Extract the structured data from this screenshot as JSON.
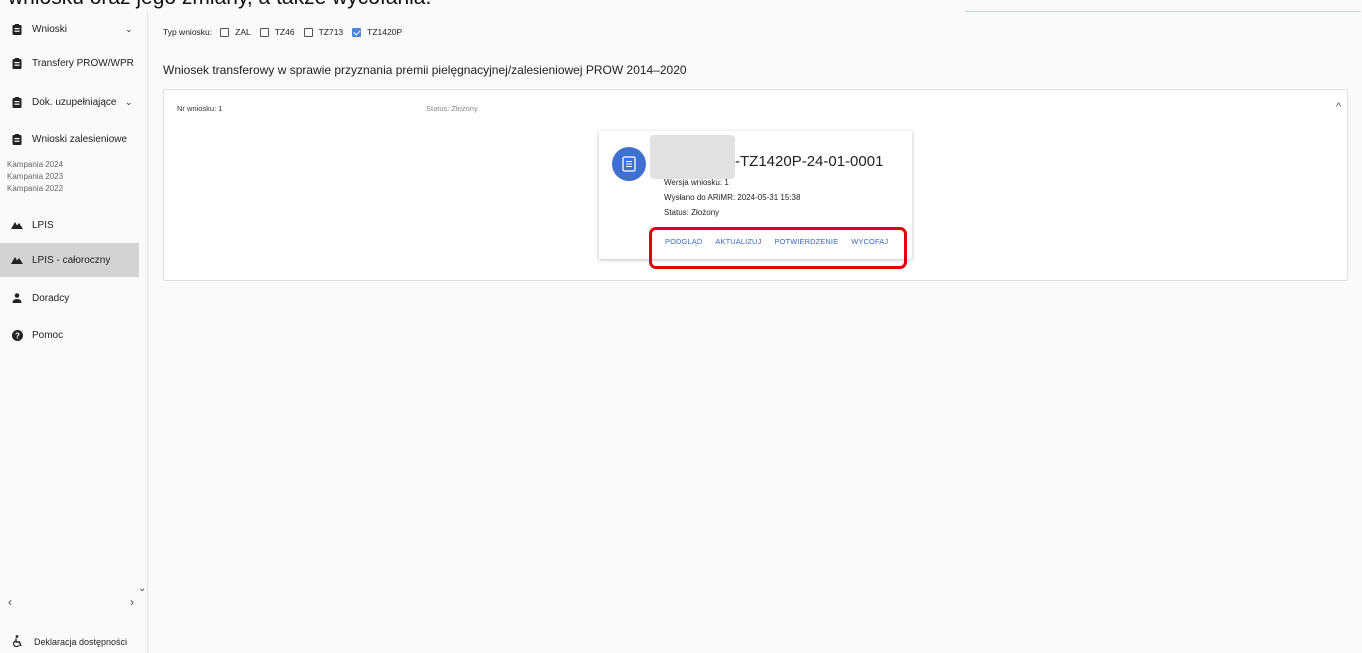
{
  "caption": {
    "text": "wniosku oraz jego zmiany, a także wycofania."
  },
  "sidebar": {
    "items": [
      {
        "label": "Wnioski",
        "icon": "clipboard-icon",
        "chevron": "⌄"
      },
      {
        "label": "Transfery PROW/WPR",
        "icon": "clipboard-icon"
      },
      {
        "label": "Dok. uzupełniające",
        "icon": "clipboard-icon",
        "chevron": "⌄"
      },
      {
        "label": "Wnioski zalesieniowe",
        "icon": "clipboard-icon"
      },
      {
        "label": "LPIS",
        "icon": "mountain-icon"
      },
      {
        "label": "LPIS - całoroczny",
        "icon": "mountain-icon"
      },
      {
        "label": "Doradcy",
        "icon": "person-icon"
      },
      {
        "label": "Pomoc",
        "icon": "help-icon"
      }
    ],
    "sub_items": [
      "Kampania 2024",
      "Kampania 2023",
      "Kampania 2022"
    ],
    "footer": {
      "label": "Deklaracja dostępności",
      "icon": "accessibility-icon"
    }
  },
  "filter": {
    "label": "Typ wniosku:",
    "options": [
      {
        "label": "ZAL",
        "checked": false
      },
      {
        "label": "TZ46",
        "checked": false
      },
      {
        "label": "TZ713",
        "checked": false
      },
      {
        "label": "TZ1420P",
        "checked": true
      }
    ]
  },
  "main": {
    "title": "Wniosek transferowy w sprawie przyznania premii pielęgnacyjnej/zalesieniowej PROW 2014–2020",
    "panel": {
      "nr": "Nr wniosku: 1",
      "status": "Status: Złożony",
      "card": {
        "app_number": "-TZ1420P-24-01-0001",
        "version": "Wersja wniosku: 1",
        "sent": "Wysłano do ARiMR: 2024-05-31 15:38",
        "status": "Status: Złożony",
        "actions": [
          "PODGLĄD",
          "AKTUALIZUJ",
          "POTWIERDZENIE",
          "WYCOFAJ"
        ]
      }
    }
  },
  "colors": {
    "accent": "#3f6fcf",
    "link": "#3a67c5",
    "highlight": "#e0000b",
    "active_bg": "#d3d3d3"
  }
}
